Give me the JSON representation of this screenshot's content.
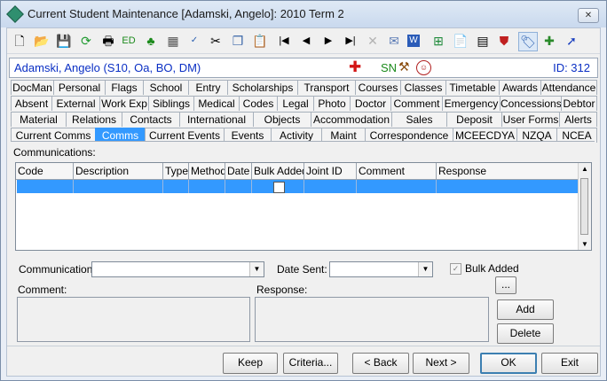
{
  "window": {
    "title": "Current Student Maintenance  [Adamski, Angelo]:  2010 Term 2"
  },
  "toolbar": {
    "icons": [
      "new-icon",
      "open-folder-icon",
      "save-icon",
      "refresh-icon",
      "print-icon",
      "edit-icon",
      "tree-icon",
      "calculator-icon",
      "spellcheck-icon",
      "cut-icon",
      "copy-icon",
      "paste-icon",
      "first-record-icon",
      "previous-record-icon",
      "next-record-icon",
      "last-record-icon",
      "delete-icon",
      "email-icon",
      "word-icon",
      "network-icon",
      "clipboard-icon",
      "calendar-icon",
      "filter-icon",
      "tag-icon",
      "add-note-icon",
      "arrow-icon"
    ]
  },
  "student": {
    "name": "Adamski, Angelo (S10, Oa, BO, DM)",
    "flag_text": "SN",
    "id_text": "ID: 312",
    "colors": {
      "name": "#0a2fc4",
      "medical": "#d31515",
      "sn": "#1b8a1b"
    }
  },
  "tabs": {
    "row1": [
      "DocMan",
      "Personal",
      "Flags",
      "School",
      "Entry",
      "Scholarships",
      "Transport",
      "Courses",
      "Classes",
      "Timetable",
      "Awards",
      "Attendance"
    ],
    "row2": [
      "Absent",
      "External",
      "Work Exp",
      "Siblings",
      "Medical",
      "Codes",
      "Legal",
      "Photo",
      "Doctor",
      "Comment",
      "Emergency",
      "Concessions",
      "Debtor"
    ],
    "row3": [
      "Material",
      "Relations",
      "Contacts",
      "International",
      "Objects",
      "Accommodation",
      "Sales",
      "Deposit",
      "User Forms",
      "Alerts"
    ],
    "row4": [
      "Current Comms",
      "Comms",
      "Current Events",
      "Events",
      "Activity",
      "Maint",
      "Correspondence",
      "MCEECDYA",
      "NZQA",
      "NCEA"
    ],
    "active": "Comms",
    "active_color": "#3399ff"
  },
  "comms": {
    "section_label": "Communications:",
    "columns": [
      "Code",
      "Description",
      "Type",
      "Method",
      "Date",
      "Bulk Added",
      "Joint ID",
      "Comment",
      "Response"
    ],
    "rows": [
      {
        "code": "",
        "description": "",
        "type": "",
        "method": "",
        "date": "",
        "bulk_added": false,
        "joint_id": "",
        "comment": "",
        "response": ""
      }
    ],
    "communication_label": "Communication:",
    "communication_value": "",
    "date_sent_label": "Date Sent:",
    "date_sent_value": "",
    "bulk_added_label": "Bulk Added",
    "bulk_added_checked": true,
    "comment_label": "Comment:",
    "response_label": "Response:",
    "ellipsis_label": "...",
    "add_label": "Add",
    "delete_label": "Delete"
  },
  "footer": {
    "keep": "Keep",
    "criteria": "Criteria...",
    "back": "< Back",
    "next": "Next >",
    "ok": "OK",
    "exit": "Exit"
  }
}
